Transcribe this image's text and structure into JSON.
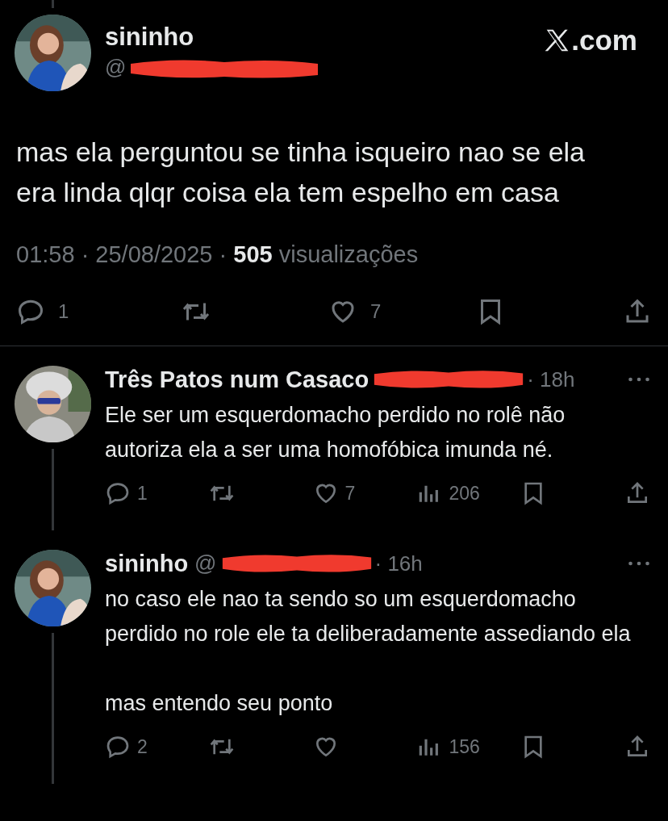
{
  "brand": {
    "suffix": ".com"
  },
  "tweet": {
    "name": "sininho",
    "handle_prefix": "@",
    "text": "mas ela perguntou se tinha isqueiro nao se ela era linda qlqr coisa ela tem espelho em casa",
    "meta": "01:58 · 25/08/2025 · **505** visualizações",
    "actions": [
      {
        "kind": "reply",
        "count": "1"
      },
      {
        "kind": "retweet"
      },
      {
        "kind": "like",
        "count": "7"
      },
      {
        "kind": "bookmark"
      },
      {
        "kind": "share"
      }
    ]
  },
  "replies": [
    {
      "name": "Três Patos num Casaco",
      "age": "· 18h",
      "paragraphs": [
        "Ele ser um esquerdomacho perdido no rolê não autoriza ela a ser uma homofóbica imunda né."
      ],
      "actions": [
        {
          "kind": "reply",
          "count": "1"
        },
        {
          "kind": "retweet"
        },
        {
          "kind": "like",
          "count": "7"
        },
        {
          "kind": "views",
          "count": "206"
        },
        {
          "kind": "bookmark"
        },
        {
          "kind": "share"
        }
      ]
    },
    {
      "name": "sininho",
      "handle_prefix": "@",
      "age": "· 16h",
      "paragraphs": [
        "no caso ele nao ta sendo so um esquerdomacho perdido no role ele ta deliberadamente assediando ela",
        "mas entendo seu ponto"
      ],
      "actions": [
        {
          "kind": "reply",
          "count": "2"
        },
        {
          "kind": "retweet"
        },
        {
          "kind": "like"
        },
        {
          "kind": "views",
          "count": "156"
        },
        {
          "kind": "bookmark"
        },
        {
          "kind": "share"
        }
      ]
    }
  ]
}
